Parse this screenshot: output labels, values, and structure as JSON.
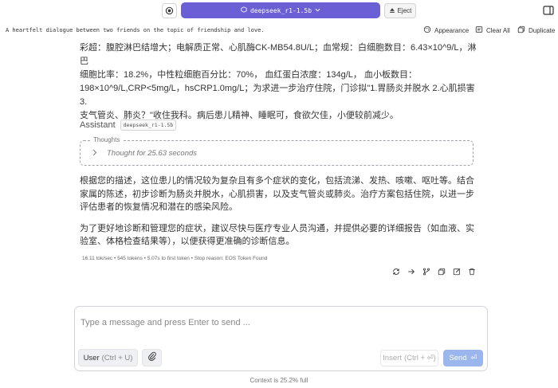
{
  "topbar": {
    "model_name": "deepseek_r1-1.5b",
    "eject_label": "Eject"
  },
  "subheader": {
    "system_prompt": "A heartfelt dialogue between two friends on the topic of friendship and love.",
    "appearance_label": "Appearance",
    "clear_all_label": "Clear All",
    "duplicate_label": "Duplicate"
  },
  "user_message": {
    "lines": [
      "彩超：腹腔淋巴结增大；电解质正常、心肌酶CK-MB54.8U/L；血常规：白细胞数目：6.43×10^9/L，淋巴",
      "细胞比率：18.2%，中性粒细胞百分比：70%， 血红蛋白浓度：134g/L， 血小板数目：",
      "198×10^9/L,CRP<5mg/L，hsCRP1.0mg/L；为求进一步治疗住院，门诊拟\"1.胃肠炎并脱水 2.心肌损害3.",
      "支气管炎、肺炎？\"收住我科。病后患儿精神、睡眠可，食欲欠佳，小便较前减少。"
    ]
  },
  "assistant": {
    "label": "Assistant",
    "model_tag": "deepseek_r1-1.5b",
    "thoughts_legend": "Thoughts",
    "thoughts_text": "Thought for 25.63 seconds",
    "paragraphs": [
      "根据您的描述，这位患儿的情况较为复杂且有多个症状的变化，包括流涕、发热、咳嗽、呕吐等。结合家属的陈述，初步诊断为肠炎并脱水，心肌损害，以及支气管炎或肺炎。治疗方案包括住院，以进一步评估患者的恢复情况和潜在的感染风险。",
      "为了更好地诊断和管理您的症状，建议尽快与医疗专业人员沟通，并提供必要的详细报告（如血液、实验室、体格检查结果等），以便获得更准确的诊断信息。"
    ],
    "stats": "16.11 tok/sec • 545 tokens • 5.07s to first token • Stop reason: EOS Token Found"
  },
  "composer": {
    "placeholder": "Type a message and press Enter to send ...",
    "role_label": "User",
    "role_hint": "(Ctrl + U)",
    "insert_label": "Insert",
    "insert_hint": "(Ctrl + ⏎)",
    "send_label": "Send",
    "send_icon": "⏎"
  },
  "footer": {
    "context": "Context is 25.2% full"
  },
  "colors": {
    "accent": "#6b5fd6",
    "send_button": "#9bb6ec"
  },
  "icons": {
    "action_icons": [
      "regenerate-icon",
      "continue-icon",
      "branch-icon",
      "copy-icon",
      "edit-icon",
      "delete-icon"
    ]
  }
}
